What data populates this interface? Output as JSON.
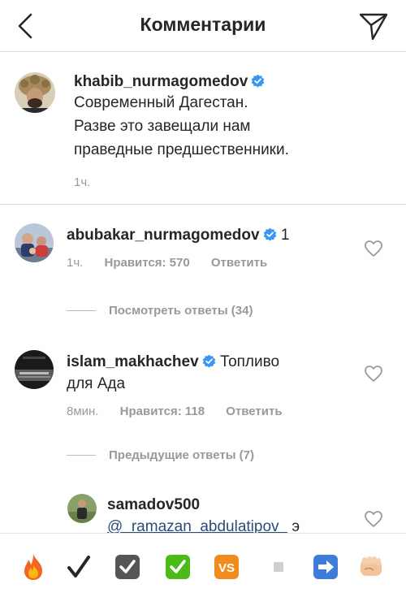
{
  "header": {
    "title": "Комментарии",
    "back_icon": "chevron-left-icon",
    "send_icon": "paper-plane-icon"
  },
  "post": {
    "username": "khabib_nurmagomedov",
    "verified": true,
    "text_lines": [
      "Современный Дагестан.",
      "Разве это завещали нам",
      "праведные предшественники."
    ],
    "time": "1ч."
  },
  "comments": [
    {
      "username": "abubakar_nurmagomedov",
      "verified": true,
      "text": "1",
      "time": "1ч.",
      "likes": "Нравится: 570",
      "reply_label": "Ответить"
    },
    {
      "username": "islam_makhachev",
      "verified": true,
      "text_first": "Топливо",
      "text_second": "для Ада",
      "time": "8мин.",
      "likes": "Нравится: 118",
      "reply_label": "Ответить"
    }
  ],
  "view_replies_1": "Посмотреть ответы (34)",
  "view_replies_2": "Предыдущие ответы (7)",
  "reply": {
    "username": "samadov500",
    "mention": "@_ramazan_abdulatipov_",
    "text": "э"
  },
  "emoji_bar": [
    "fire-icon",
    "checkmark-icon",
    "checkbox-checked-icon",
    "green-check-icon",
    "vs-icon",
    "small-square-icon",
    "right-arrow-icon",
    "fist-icon"
  ],
  "colors": {
    "verified_blue": "#3897f0",
    "secondary_text": "#999999",
    "mention": "#2b4c78",
    "divider": "#dbdbdb"
  }
}
